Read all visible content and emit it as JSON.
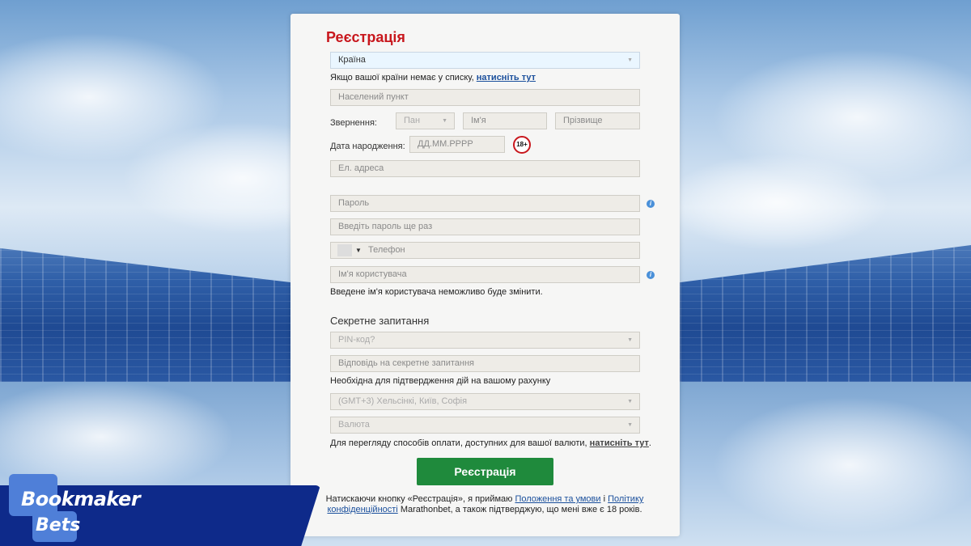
{
  "form": {
    "title": "Реєстрація",
    "country_placeholder": "Країна",
    "country_note": "Якщо вашої країни немає у списку,",
    "country_link": "натисніть тут",
    "city_placeholder": "Населений пункт",
    "salutation_label": "Звернення:",
    "salutation_value": "Пан",
    "first_name_placeholder": "Ім'я",
    "last_name_placeholder": "Прізвище",
    "birthdate_label": "Дата народження:",
    "birthdate_placeholder": "ДД.ММ.РРРР",
    "age_badge": "18+",
    "email_placeholder": "Ел. адреса",
    "password_placeholder": "Пароль",
    "password_repeat_placeholder": "Введіть пароль ще раз",
    "phone_placeholder": "Телефон",
    "username_placeholder": "Ім'я користувача",
    "username_note": "Введене ім'я користувача неможливо буде змінити.",
    "info_icon": "i",
    "secret_section_title": "Секретне запитання",
    "secret_question_placeholder": "PIN-код?",
    "secret_answer_placeholder": "Відповідь на секретне запитання",
    "secret_note": "Необхідна для підтвердження дій на вашому рахунку",
    "timezone_value": "(GMT+3) Хельсінкі, Київ, Софія",
    "currency_placeholder": "Валюта",
    "currency_note": "Для перегляду способів оплати, доступних для вашої валюти,",
    "currency_link": "натисніть тут",
    "currency_note_end": ".",
    "submit_label": "Реєстрація",
    "terms_text_1": "Натискаючи кнопку «Реєстрація», я приймаю",
    "terms_link_1": "Положення та умови",
    "terms_text_2": "і",
    "terms_link_2": "Політику конфіденційності",
    "terms_text_3": "Marathonbet, а також підтверджую, що мені вже є 18 років."
  },
  "logo": {
    "line1": "Bookmaker",
    "line2": "Bets"
  },
  "colors": {
    "title": "#c8171d",
    "submit": "#1f8a3c",
    "link": "#1a4f9c",
    "logo_bg": "#0e2a8a"
  }
}
